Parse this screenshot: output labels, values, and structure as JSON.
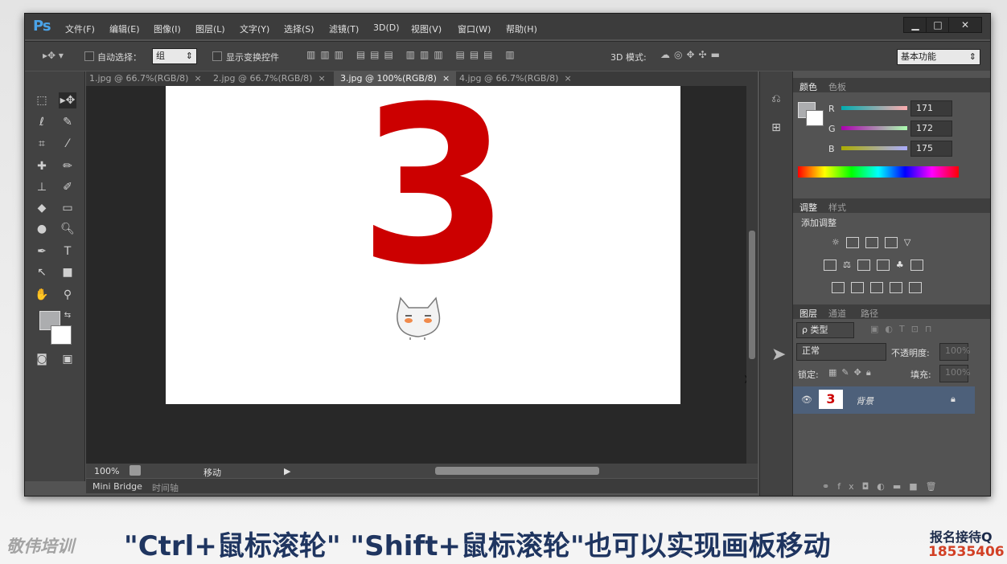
{
  "app": {
    "logo": "Ps",
    "menu": [
      "文件(F)",
      "编辑(E)",
      "图像(I)",
      "图层(L)",
      "文字(Y)",
      "选择(S)",
      "滤镜(T)",
      "3D(D)",
      "视图(V)",
      "窗口(W)",
      "帮助(H)"
    ],
    "window_controls": {
      "minimize": "▁",
      "maximize": "□",
      "close": "✕"
    }
  },
  "options_bar": {
    "auto_select_label": "自动选择：",
    "auto_select_value": "组",
    "show_transform_label": "显示变换控件",
    "mode_3d_label": "3D 模式:",
    "workspace_value": "基本功能"
  },
  "tabs": [
    {
      "label": "1.jpg @ 66.7%(RGB/8)",
      "close": "×",
      "active": false
    },
    {
      "label": "2.jpg @ 66.7%(RGB/8)",
      "close": "×",
      "active": false
    },
    {
      "label": "3.jpg @ 100%(RGB/8)",
      "close": "×",
      "active": true
    },
    {
      "label": "4.jpg @ 66.7%(RGB/8)",
      "close": "×",
      "active": false
    }
  ],
  "document": {
    "digit": "3"
  },
  "status": {
    "zoom": "100%",
    "info": "移动"
  },
  "bottom_tabs": {
    "mini_bridge": "Mini Bridge",
    "timeline": "时间轴"
  },
  "color_panel": {
    "tabs": [
      "颜色",
      "色板"
    ],
    "channels": [
      {
        "label": "R",
        "value": "171"
      },
      {
        "label": "G",
        "value": "172"
      },
      {
        "label": "B",
        "value": "175"
      }
    ]
  },
  "adjust_panel": {
    "tabs": [
      "调整",
      "样式"
    ],
    "title": "添加调整"
  },
  "layers_panel": {
    "tabs": [
      "图层",
      "通道",
      "路径"
    ],
    "filter_label": "ρ 类型",
    "blend_mode": "正常",
    "opacity_label": "不透明度:",
    "opacity_value": "100%",
    "lock_label": "锁定:",
    "fill_label": "填充:",
    "fill_value": "100%",
    "layer": {
      "thumb": "3",
      "name": "背景"
    }
  },
  "overlay": {
    "brand": "敬伟培训",
    "subtitle": "\"Ctrl+鼠标滚轮\" \"Shift+鼠标滚轮\"也可以实现画板移动",
    "contact_line1": "报名接待Q",
    "contact_line2": "18535406"
  },
  "colors": {
    "accent_red": "#cc0000",
    "subtitle": "#1f3560",
    "panel_bg": "#535353"
  }
}
